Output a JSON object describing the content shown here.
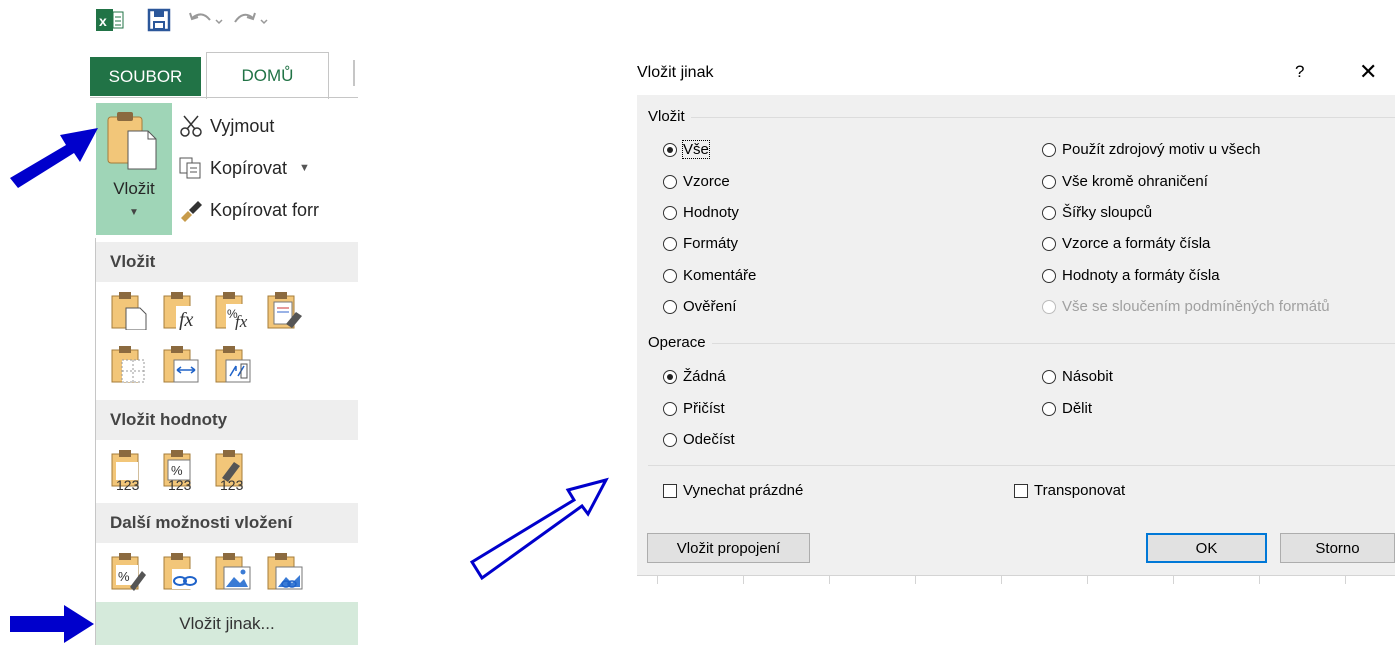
{
  "ribbon": {
    "tab_file": "SOUBOR",
    "tab_home": "DOMŮ",
    "paste_label": "Vložit",
    "cut_label": "Vyjmout",
    "copy_label": "Kopírovat",
    "format_painter_label": "Kopírovat forr"
  },
  "paste_menu": {
    "section_paste": "Vložit",
    "section_values": "Vložit hodnoty",
    "section_other": "Další možnosti vložení",
    "values_icon_1": "123",
    "values_icon_2": "123",
    "values_icon_3": "123",
    "footer_label": "Vložit jinak..."
  },
  "dialog": {
    "title": "Vložit jinak",
    "help": "?",
    "close": "✕",
    "paste_group": "Vložit",
    "paste_options_left": [
      "Vše",
      "Vzorce",
      "Hodnoty",
      "Formáty",
      "Komentáře",
      "Ověření"
    ],
    "paste_options_right": [
      "Použít zdrojový motiv u všech",
      "Vše kromě ohraničení",
      "Šířky sloupců",
      "Vzorce a formáty čísla",
      "Hodnoty a formáty čísla",
      "Vše se sloučením podmíněných formátů"
    ],
    "operation_group": "Operace",
    "operation_left": [
      "Žádná",
      "Přičíst",
      "Odečíst"
    ],
    "operation_right": [
      "Násobit",
      "Dělit"
    ],
    "skip_blanks": "Vynechat prázdné",
    "transpose": "Transponovat",
    "paste_link": "Vložit propojení",
    "ok": "OK",
    "cancel": "Storno"
  },
  "colors": {
    "excel_green": "#217346",
    "highlight_green": "#9fd5b7",
    "arrow_blue": "#0000cc",
    "dialog_bg": "#f0f0f0",
    "default_button_border": "#0078d7"
  }
}
